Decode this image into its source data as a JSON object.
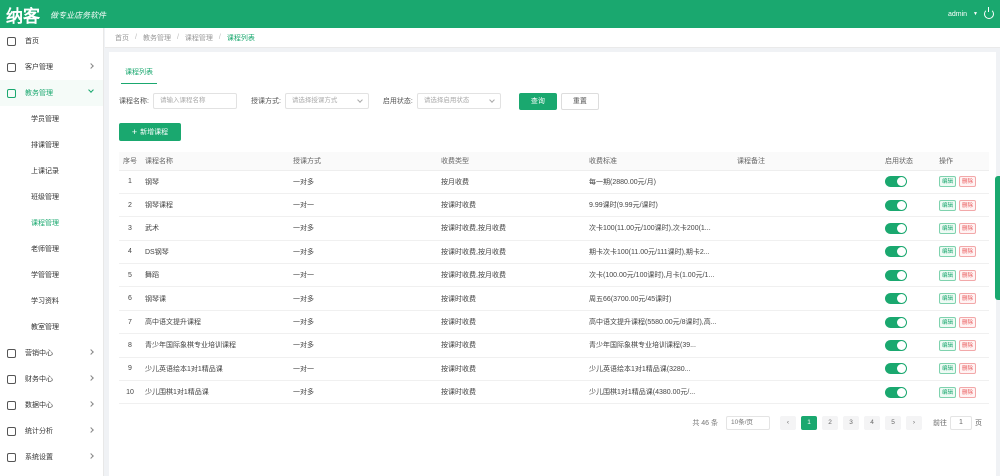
{
  "header": {
    "logo": "纳客",
    "slogan": "做专业店务软件",
    "user": "admin"
  },
  "breadcrumb": [
    "首页",
    "教务管理",
    "课程管理",
    "课程列表"
  ],
  "sidebar": {
    "items": [
      {
        "label": "首页",
        "icon": "home-icon"
      },
      {
        "label": "客户管理",
        "icon": "user-icon"
      },
      {
        "label": "教务管理",
        "icon": "book-icon",
        "open": true
      }
    ],
    "sub_items": [
      "学员管理",
      "排课管理",
      "上课记录",
      "班级管理",
      "课程管理",
      "老师管理",
      "学管管理",
      "学习资料",
      "教室管理"
    ],
    "items_after": [
      {
        "label": "营销中心",
        "icon": "megaphone-icon"
      },
      {
        "label": "财务中心",
        "icon": "wallet-icon"
      },
      {
        "label": "数据中心",
        "icon": "chart-icon"
      },
      {
        "label": "统计分析",
        "icon": "analysis-icon"
      },
      {
        "label": "系统设置",
        "icon": "gear-icon"
      }
    ]
  },
  "page": {
    "tab": "课程列表"
  },
  "filters": {
    "name_label": "课程名称:",
    "name_placeholder": "请输入课程名称",
    "mode_label": "授课方式:",
    "mode_placeholder": "请选择授课方式",
    "status_label": "启用状态:",
    "status_placeholder": "请选择启用状态",
    "query": "查询",
    "reset": "重置"
  },
  "add_button": "新增课程",
  "table": {
    "headers": [
      "序号",
      "课程名称",
      "授课方式",
      "收费类型",
      "收费标准",
      "课程备注",
      "启用状态",
      "操作"
    ],
    "edit_label": "编辑",
    "delete_label": "删除",
    "rows": [
      {
        "idx": "1",
        "name": "钢琴",
        "mode": "一对多",
        "fee_type": "按月收费",
        "fee_std": "每一期(2880.00元/月)",
        "remark": "",
        "enabled": true
      },
      {
        "idx": "2",
        "name": "钢琴课程",
        "mode": "一对一",
        "fee_type": "按课时收费",
        "fee_std": "9.99课时(9.99元/课时)",
        "remark": "",
        "enabled": true
      },
      {
        "idx": "3",
        "name": "武术",
        "mode": "一对多",
        "fee_type": "按课时收费,按月收费",
        "fee_std": "次卡100(11.00元/100课时),次卡200(1...",
        "remark": "",
        "enabled": true
      },
      {
        "idx": "4",
        "name": "DS钢琴",
        "mode": "一对多",
        "fee_type": "按课时收费,按月收费",
        "fee_std": "期卡次卡100(11.00元/111课时),期卡2...",
        "remark": "",
        "enabled": true
      },
      {
        "idx": "5",
        "name": "舞蹈",
        "mode": "一对一",
        "fee_type": "按课时收费,按月收费",
        "fee_std": "次卡(100.00元/100课时),月卡(1.00元/1...",
        "remark": "",
        "enabled": true
      },
      {
        "idx": "6",
        "name": "钢琴课",
        "mode": "一对多",
        "fee_type": "按课时收费",
        "fee_std": "周五66(3700.00元/45课时)",
        "remark": "",
        "enabled": true
      },
      {
        "idx": "7",
        "name": "高中语文提升课程",
        "mode": "一对多",
        "fee_type": "按课时收费",
        "fee_std": "高中语文提升课程(5580.00元/8课时),高...",
        "remark": "",
        "enabled": true
      },
      {
        "idx": "8",
        "name": "青少年国际象棋专业培训课程",
        "mode": "一对多",
        "fee_type": "按课时收费",
        "fee_std": "青少年国际象棋专业培训课程(39...",
        "remark": "",
        "enabled": true
      },
      {
        "idx": "9",
        "name": "少儿英语绘本1对1精品课",
        "mode": "一对一",
        "fee_type": "按课时收费",
        "fee_std": "少儿英语绘本1对1精品课(3280...",
        "remark": "",
        "enabled": true
      },
      {
        "idx": "10",
        "name": "少儿围棋1对1精品课",
        "mode": "一对多",
        "fee_type": "按课时收费",
        "fee_std": "少儿围棋1对1精品课(4380.00元/...",
        "remark": "",
        "enabled": true
      }
    ]
  },
  "pagination": {
    "total": "共 46 条",
    "page_size": "10条/页",
    "pages": [
      "1",
      "2",
      "3",
      "4",
      "5"
    ],
    "current": "1",
    "goto_label": "前往",
    "goto_value": "1",
    "goto_suffix": "页"
  },
  "colors": {
    "brand": "#1aa86f",
    "danger": "#e8585a"
  }
}
